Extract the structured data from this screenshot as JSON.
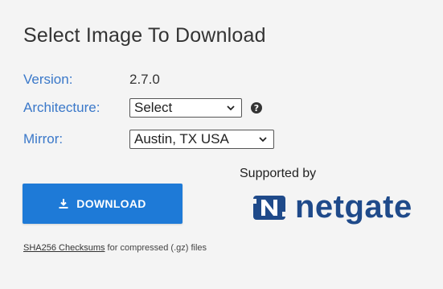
{
  "title": "Select Image To Download",
  "version": {
    "label": "Version:",
    "value": "2.7.0"
  },
  "architecture": {
    "label": "Architecture:",
    "selected": "Select",
    "help_icon": "question-circle-icon"
  },
  "mirror": {
    "label": "Mirror:",
    "selected": "Austin, TX USA"
  },
  "download_button": {
    "label": "DOWNLOAD",
    "icon": "download-icon"
  },
  "sponsor": {
    "supported_by": "Supported by",
    "logo_text": "netgate"
  },
  "footer": {
    "link_text": "SHA256 Checksums",
    "rest_text": " for compressed (.gz) files"
  },
  "colors": {
    "label_blue": "#3a78c9",
    "button_blue": "#1e7ad7",
    "netgate_navy": "#1f4a8a",
    "background": "#f4f4f4"
  }
}
